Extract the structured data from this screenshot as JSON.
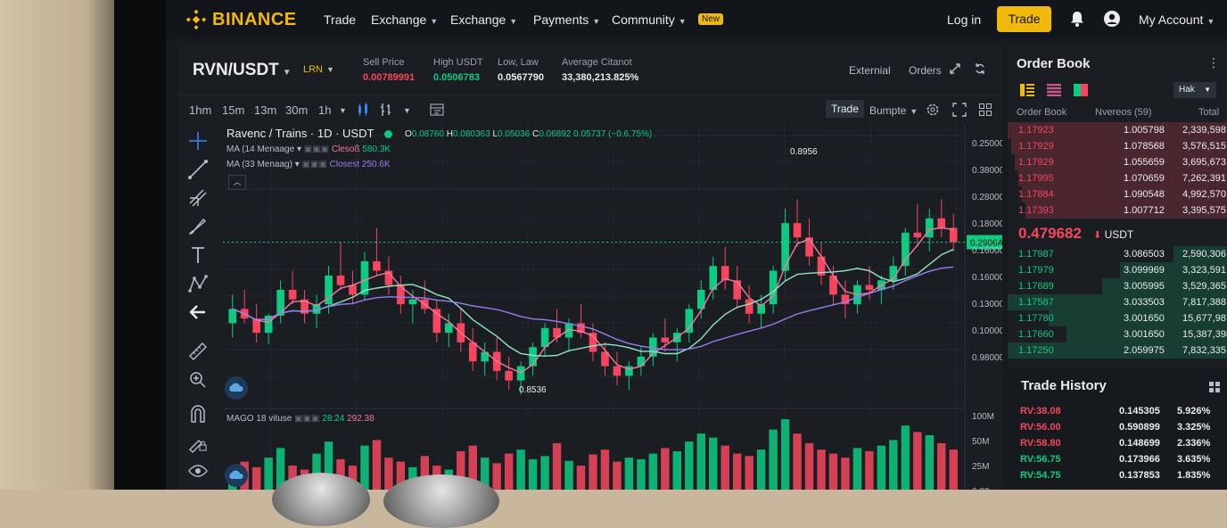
{
  "nav": {
    "brand": "BINANCE",
    "items": [
      {
        "label": "Trade",
        "caret": false
      },
      {
        "label": "Exchange",
        "caret": true
      },
      {
        "label": "Exchange",
        "caret": true
      },
      {
        "label": "Payments",
        "caret": true
      },
      {
        "label": "Community",
        "caret": true
      }
    ],
    "new_badge": "New",
    "login": "Log in",
    "trade_button": "Trade",
    "account": "My Account"
  },
  "market": {
    "pair": "RVN/USDT",
    "sub": "LRN",
    "stats": [
      {
        "label": "Sell Price",
        "value": "0.00789991",
        "color": "#f6465d"
      },
      {
        "label": "High USDT",
        "value": "0.0506783",
        "color": "#0ecb81"
      },
      {
        "label": "Low, Law",
        "value": "0.0567790",
        "color": "#eaecef"
      },
      {
        "label": "Average Citanot",
        "value": "33,380,213.825%",
        "color": "#eaecef"
      }
    ],
    "header_links": [
      "Externial",
      "Orders"
    ]
  },
  "toolbar": {
    "intervals": [
      "1hm",
      "15m",
      "13m",
      "30m",
      "1h"
    ],
    "trade": "Trade",
    "bumpte": "Bumpte"
  },
  "chart_data": {
    "type": "candlestick",
    "title": "Ravenc / Trains · 1D · USDT",
    "ohlc": {
      "o": "0.08760",
      "h": "0.080363",
      "l": "0.05036",
      "c": "0.06892",
      "change": "0.05737 (−0.6.75%)"
    },
    "indicators": [
      {
        "name": "MA (14 Menaage",
        "label": "Clesoß",
        "value": "580.3K",
        "color": "#f27aa0"
      },
      {
        "name": "MA (33 Menaag)",
        "label": "Closest",
        "value": "250.6K",
        "color": "#9a7cf0"
      }
    ],
    "y_ticks": [
      "0.25000",
      "0.38000",
      "0.28000",
      "0.18000",
      "0.16000",
      "0.16000",
      "0.13000",
      "0.10000",
      "0.98000"
    ],
    "current_price_label": "0.2906A",
    "annotation_high": "0.8956",
    "annotation_low": "0.8536",
    "volume_label": "MAGO 18 vituse",
    "volume_values": [
      "28:24",
      "292.38"
    ],
    "volume_ticks": [
      "100M",
      "50M",
      "25M",
      "6.00"
    ],
    "candles": [
      [
        0.14,
        0.17,
        0.125,
        0.155
      ],
      [
        0.155,
        0.175,
        0.14,
        0.145
      ],
      [
        0.145,
        0.16,
        0.12,
        0.13
      ],
      [
        0.13,
        0.15,
        0.118,
        0.148
      ],
      [
        0.148,
        0.185,
        0.14,
        0.175
      ],
      [
        0.175,
        0.195,
        0.16,
        0.165
      ],
      [
        0.165,
        0.175,
        0.14,
        0.15
      ],
      [
        0.15,
        0.17,
        0.135,
        0.16
      ],
      [
        0.16,
        0.2,
        0.15,
        0.19
      ],
      [
        0.19,
        0.225,
        0.175,
        0.18
      ],
      [
        0.18,
        0.195,
        0.16,
        0.17
      ],
      [
        0.17,
        0.215,
        0.165,
        0.205
      ],
      [
        0.205,
        0.24,
        0.19,
        0.195
      ],
      [
        0.195,
        0.21,
        0.17,
        0.18
      ],
      [
        0.18,
        0.19,
        0.15,
        0.16
      ],
      [
        0.16,
        0.175,
        0.14,
        0.165
      ],
      [
        0.165,
        0.185,
        0.15,
        0.155
      ],
      [
        0.155,
        0.165,
        0.12,
        0.13
      ],
      [
        0.13,
        0.15,
        0.115,
        0.14
      ],
      [
        0.14,
        0.155,
        0.11,
        0.12
      ],
      [
        0.12,
        0.135,
        0.09,
        0.1
      ],
      [
        0.1,
        0.12,
        0.085,
        0.11
      ],
      [
        0.11,
        0.125,
        0.08,
        0.09
      ],
      [
        0.09,
        0.105,
        0.07,
        0.08
      ],
      [
        0.08,
        0.1,
        0.065,
        0.095
      ],
      [
        0.095,
        0.12,
        0.085,
        0.115
      ],
      [
        0.115,
        0.14,
        0.105,
        0.135
      ],
      [
        0.135,
        0.155,
        0.12,
        0.125
      ],
      [
        0.125,
        0.145,
        0.11,
        0.14
      ],
      [
        0.14,
        0.16,
        0.125,
        0.13
      ],
      [
        0.13,
        0.14,
        0.1,
        0.11
      ],
      [
        0.11,
        0.12,
        0.085,
        0.095
      ],
      [
        0.095,
        0.11,
        0.075,
        0.085
      ],
      [
        0.085,
        0.1,
        0.07,
        0.095
      ],
      [
        0.095,
        0.115,
        0.085,
        0.105
      ],
      [
        0.105,
        0.13,
        0.095,
        0.125
      ],
      [
        0.125,
        0.145,
        0.11,
        0.12
      ],
      [
        0.12,
        0.135,
        0.1,
        0.13
      ],
      [
        0.13,
        0.16,
        0.12,
        0.155
      ],
      [
        0.155,
        0.185,
        0.145,
        0.175
      ],
      [
        0.175,
        0.21,
        0.165,
        0.2
      ],
      [
        0.2,
        0.22,
        0.175,
        0.185
      ],
      [
        0.185,
        0.2,
        0.155,
        0.165
      ],
      [
        0.165,
        0.18,
        0.14,
        0.15
      ],
      [
        0.15,
        0.17,
        0.135,
        0.16
      ],
      [
        0.16,
        0.2,
        0.15,
        0.195
      ],
      [
        0.195,
        0.26,
        0.185,
        0.245
      ],
      [
        0.245,
        0.27,
        0.22,
        0.23
      ],
      [
        0.23,
        0.25,
        0.2,
        0.21
      ],
      [
        0.21,
        0.225,
        0.18,
        0.19
      ],
      [
        0.19,
        0.2,
        0.16,
        0.17
      ],
      [
        0.17,
        0.185,
        0.145,
        0.16
      ],
      [
        0.16,
        0.185,
        0.15,
        0.18
      ],
      [
        0.18,
        0.2,
        0.165,
        0.175
      ],
      [
        0.175,
        0.19,
        0.16,
        0.185
      ],
      [
        0.185,
        0.21,
        0.175,
        0.2
      ],
      [
        0.2,
        0.24,
        0.19,
        0.235
      ],
      [
        0.235,
        0.265,
        0.22,
        0.23
      ],
      [
        0.23,
        0.26,
        0.215,
        0.25
      ],
      [
        0.25,
        0.27,
        0.23,
        0.24
      ],
      [
        0.24,
        0.255,
        0.215,
        0.225
      ]
    ],
    "volumes": [
      20,
      35,
      28,
      40,
      52,
      30,
      25,
      45,
      60,
      38,
      30,
      55,
      62,
      40,
      35,
      28,
      42,
      30,
      25,
      48,
      55,
      40,
      33,
      45,
      50,
      38,
      42,
      58,
      36,
      30,
      44,
      50,
      35,
      40,
      38,
      45,
      52,
      48,
      60,
      70,
      65,
      55,
      45,
      42,
      50,
      75,
      88,
      70,
      58,
      50,
      45,
      40,
      52,
      48,
      55,
      62,
      80,
      72,
      68,
      58,
      50
    ],
    "ylim": [
      0.06,
      0.29
    ]
  },
  "orderbook": {
    "title": "Order Book",
    "hak": "Hak",
    "columns": [
      "Order Book",
      "Nvereos (59)",
      "Total"
    ],
    "asks": [
      [
        "1.17923",
        "1.005798",
        "2,339,598"
      ],
      [
        "1.17929",
        "1.078568",
        "3,576,515"
      ],
      [
        "1.17929",
        "1.055659",
        "3,695,673"
      ],
      [
        "1.17995",
        "1.070659",
        "7,262,391"
      ],
      [
        "1.17884",
        "1.090548",
        "4,992,570"
      ],
      [
        "1.17393",
        "1.007712",
        "3,395,575"
      ]
    ],
    "last_price": "0.479682",
    "unit": "USDT",
    "bids": [
      [
        "1.17987",
        "3.086503",
        "2,590,306"
      ],
      [
        "1.17979",
        "3.099969",
        "3,323,591"
      ],
      [
        "1.17689",
        "3.005995",
        "3,529,365"
      ],
      [
        "1.17587",
        "3.033503",
        "7,817,388"
      ],
      [
        "1.17780",
        "3.001650",
        "15,677,987"
      ],
      [
        "1.17660",
        "3.001650",
        "15,387,398"
      ],
      [
        "1.17250",
        "2.059975",
        "7,832,335"
      ]
    ]
  },
  "trade_history": {
    "title": "Trade History",
    "rows": [
      {
        "pair": "RV:38.08",
        "price": "0.145305",
        "pct": "5.926%",
        "color": "#f6465d"
      },
      {
        "pair": "RV:56.00",
        "price": "0.590899",
        "pct": "3.325%",
        "color": "#f6465d"
      },
      {
        "pair": "RV:58.80",
        "price": "0.148699",
        "pct": "2.336%",
        "color": "#f6465d"
      },
      {
        "pair": "RV:56.75",
        "price": "0.173966",
        "pct": "3.635%",
        "color": "#0ecb81"
      },
      {
        "pair": "RV:54.75",
        "price": "0.137853",
        "pct": "1.835%",
        "color": "#0ecb81"
      }
    ]
  }
}
